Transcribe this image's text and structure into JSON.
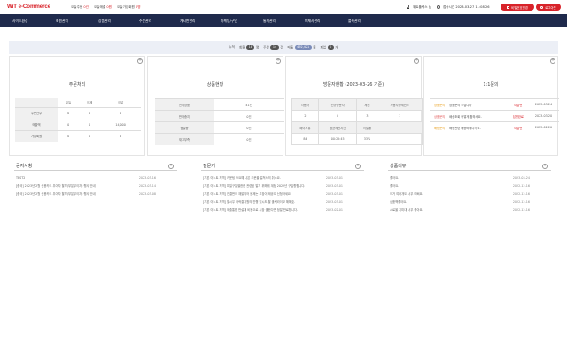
{
  "header": {
    "logo": "WiT e-Commerce",
    "stats": [
      {
        "label": "오늘주문",
        "value": "0건"
      },
      {
        "label": "오늘매출",
        "value": "0원"
      },
      {
        "label": "오늘가입회원",
        "value": "0명"
      }
    ],
    "user": "위트플렉스 님",
    "login_time": "접속시간 2023-03-27 11:08:26",
    "password_button": "비밀번호변경",
    "logout_button": "로그아웃"
  },
  "nav": [
    "사이트환경",
    "회원관리",
    "상품관리",
    "주문관리",
    "게시판관리",
    "마케팅/구인",
    "통계관리",
    "매체사관리",
    "블록관리"
  ],
  "counter": {
    "prefix": "누적",
    "items": [
      {
        "label": "회원",
        "value": "18",
        "unit": "명"
      },
      {
        "label": "주문",
        "value": "14",
        "unit": "건"
      },
      {
        "label": "매출",
        "value": "492,421",
        "unit": "원"
      },
      {
        "label": "폐업",
        "value": "0",
        "unit": "개"
      }
    ]
  },
  "order_card": {
    "title": "주문처리",
    "columns": [
      "오늘",
      "어제",
      "이달"
    ],
    "rows": [
      {
        "label": "주문건수",
        "values": [
          "0",
          "0",
          "1"
        ]
      },
      {
        "label": "매출액",
        "values": [
          "0",
          "0",
          "14,000"
        ]
      },
      {
        "label": "가입회원",
        "values": [
          "0",
          "0",
          "6"
        ]
      }
    ]
  },
  "product_card": {
    "title": "상품현황",
    "rows": [
      {
        "label": "전체상품",
        "value": "41건"
      },
      {
        "label": "판매중지",
        "value": "0건"
      },
      {
        "label": "품절중",
        "value": "0건"
      },
      {
        "label": "재고부족",
        "value": "0건"
      }
    ]
  },
  "visit_card": {
    "title": "방문자현황 (2023-03-26 기준)",
    "header1": [
      "사용자",
      "신규방문자",
      "세션",
      "사용자당세션수"
    ],
    "row1": [
      "2",
      "0",
      "3",
      "1"
    ],
    "header2": [
      "페이지뷰",
      "평균세션시간",
      "이탈률",
      ""
    ],
    "row2": [
      "84",
      "00:25:45",
      "33%",
      ""
    ]
  },
  "qna_card": {
    "title": "1:1문의",
    "rows": [
      {
        "status": "상품문의",
        "subject": "상품문의 드립니다",
        "answer": "미답변",
        "date": "2023-03-24"
      },
      {
        "status": "상품문의",
        "subject": "배송조회 어떻게 합하세요.",
        "answer": "답변완료",
        "date": "2023-03-20"
      },
      {
        "status": "배송문의",
        "subject": "배송관련 배송비에다가요.",
        "answer": "미답변",
        "date": "2023-02-20"
      }
    ]
  },
  "notice_panel": {
    "title": "공지사항",
    "items": [
      {
        "text": "TEST2",
        "date": "2023-03-16"
      },
      {
        "text": "[중국] 2023년 2월 신용카드 무이자 할부(부분무이자) 행사 안내",
        "date": "2023-03-14"
      },
      {
        "text": "[중국] 2023년 2월 신용카드 무이자 할부(부분무이자) 행사 안내",
        "date": "2023-03-08"
      }
    ]
  },
  "event_panel": {
    "title": "질문게",
    "items": [
      {
        "text": "[기본 이노트 지역] 카운팅 토요예 나은 주문을 걸쳐서의 취소요.",
        "date": "2023-03-01"
      },
      {
        "text": "[기본 이노트 지역] 파일구분별한한 관련된 알기 위해에 계정 2022년 구입향합니다.",
        "date": "2023-03-01"
      },
      {
        "text": "[기본 이노트 지역] 연결번이 재발되어 문제는 고장이 제공으 신청하세요.",
        "date": "2023-03-01"
      },
      {
        "text": "[기본 이노트 지역] 할시우 하락결과원의 진행 있시도 할 출력라이모 해해효.",
        "date": "2023-03-01"
      },
      {
        "text": "[기본 이노트 지역] 제출통합 반설재 비용으로 시장 출한다면 정말 만료합니다.",
        "date": "2023-02-01"
      }
    ]
  },
  "review_panel": {
    "title": "상품리뷰",
    "items": [
      {
        "text": "좋아요.",
        "date": "2023-03-24"
      },
      {
        "text": "좋아요.",
        "date": "2022-12-16"
      },
      {
        "text": "이거 여러개도 너무 예뻐요.",
        "date": "2022-12-16"
      },
      {
        "text": "상품책좋아요.",
        "date": "2022-12-16"
      },
      {
        "text": "시료을 기미대 너무 좋아요.",
        "date": "2022-12-16"
      }
    ]
  }
}
